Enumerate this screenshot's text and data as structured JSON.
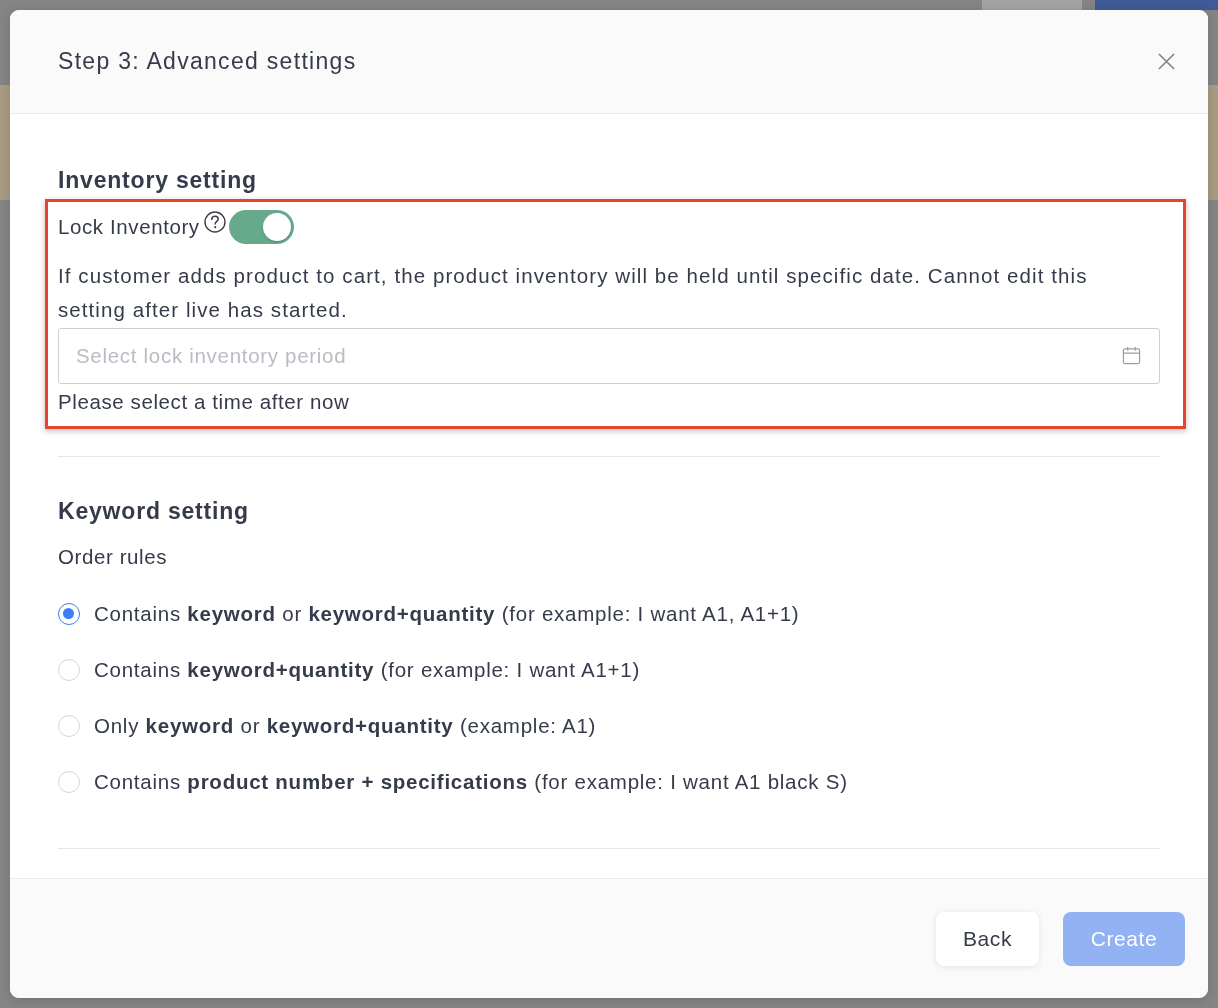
{
  "dialog": {
    "title": "Step 3: Advanced settings"
  },
  "inventory_setting": {
    "heading": "Inventory setting",
    "highlighted": true,
    "lock_inventory": {
      "label": "Lock Inventory",
      "on": true
    },
    "description": "If customer adds product to cart, the product inventory will be held until specific date. Cannot edit this setting after live has started.",
    "period_field": {
      "placeholder": "Select lock inventory period"
    },
    "hint": "Please select a time after now"
  },
  "keyword_setting": {
    "heading": "Keyword setting",
    "subheading": "Order rules",
    "options": [
      {
        "label": "Contains **keyword** or **keyword+quantity** (for example: I want A1, A1+1)",
        "selected": true
      },
      {
        "label": "Contains **keyword+quantity** (for example: I want A1+1)",
        "selected": false
      },
      {
        "label": "Only **keyword** or **keyword+quantity** (example: A1)",
        "selected": false
      },
      {
        "label": "Contains **product number + specifications** (for example: I want A1 black S)",
        "selected": false
      }
    ]
  },
  "buttons": [
    {
      "label": "Back",
      "kind": "secondary",
      "disabled": false
    },
    {
      "label": "Create",
      "kind": "primary",
      "disabled": true
    }
  ]
}
